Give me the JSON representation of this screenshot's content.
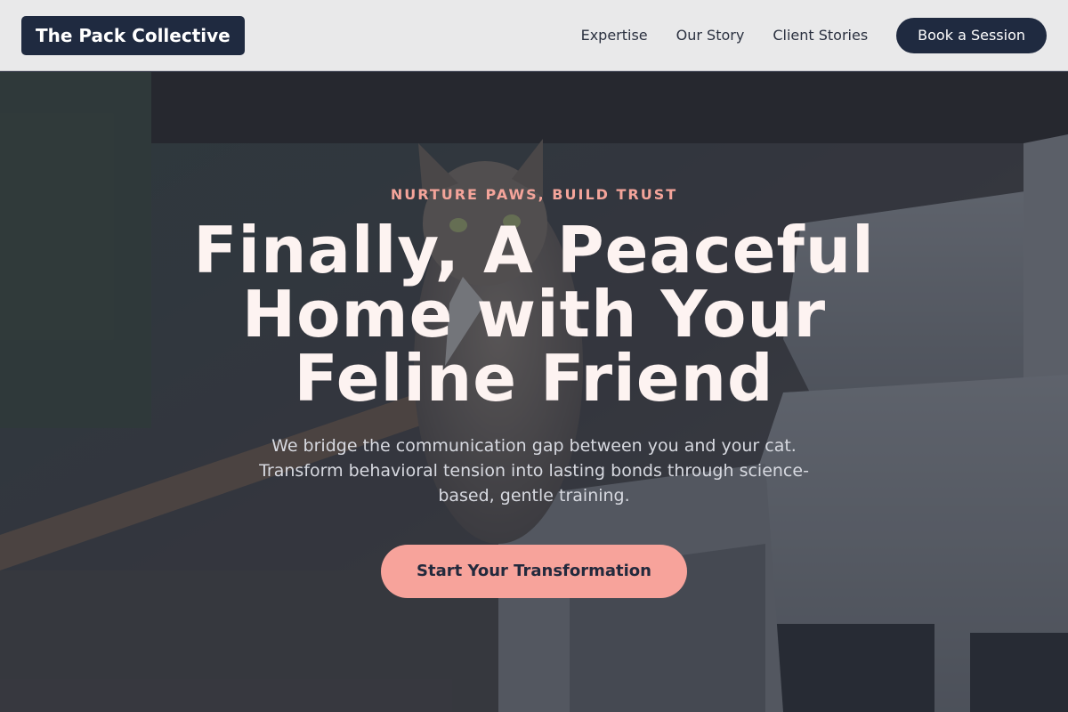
{
  "brand": {
    "name": "The Pack Collective"
  },
  "nav": {
    "links": [
      {
        "label": "Expertise"
      },
      {
        "label": "Our Story"
      },
      {
        "label": "Client Stories"
      }
    ],
    "cta_label": "Book a Session"
  },
  "hero": {
    "eyebrow": "NURTURE PAWS, BUILD TRUST",
    "headline": "Finally, A Peaceful Home with Your Feline Friend",
    "subtitle": "We bridge the communication gap between you and your cat. Transform behavioral tension into lasting bonds through science-based, gentle training.",
    "cta_label": "Start Your Transformation",
    "background": "cat-sitting-among-cinder-blocks-photo"
  },
  "colors": {
    "navy": "#1f2a40",
    "accent_pink": "#f7a39b",
    "eyebrow_pink": "#f4a49a",
    "nav_bg": "#e9e9ea",
    "headline_text": "#fdf3f1"
  }
}
